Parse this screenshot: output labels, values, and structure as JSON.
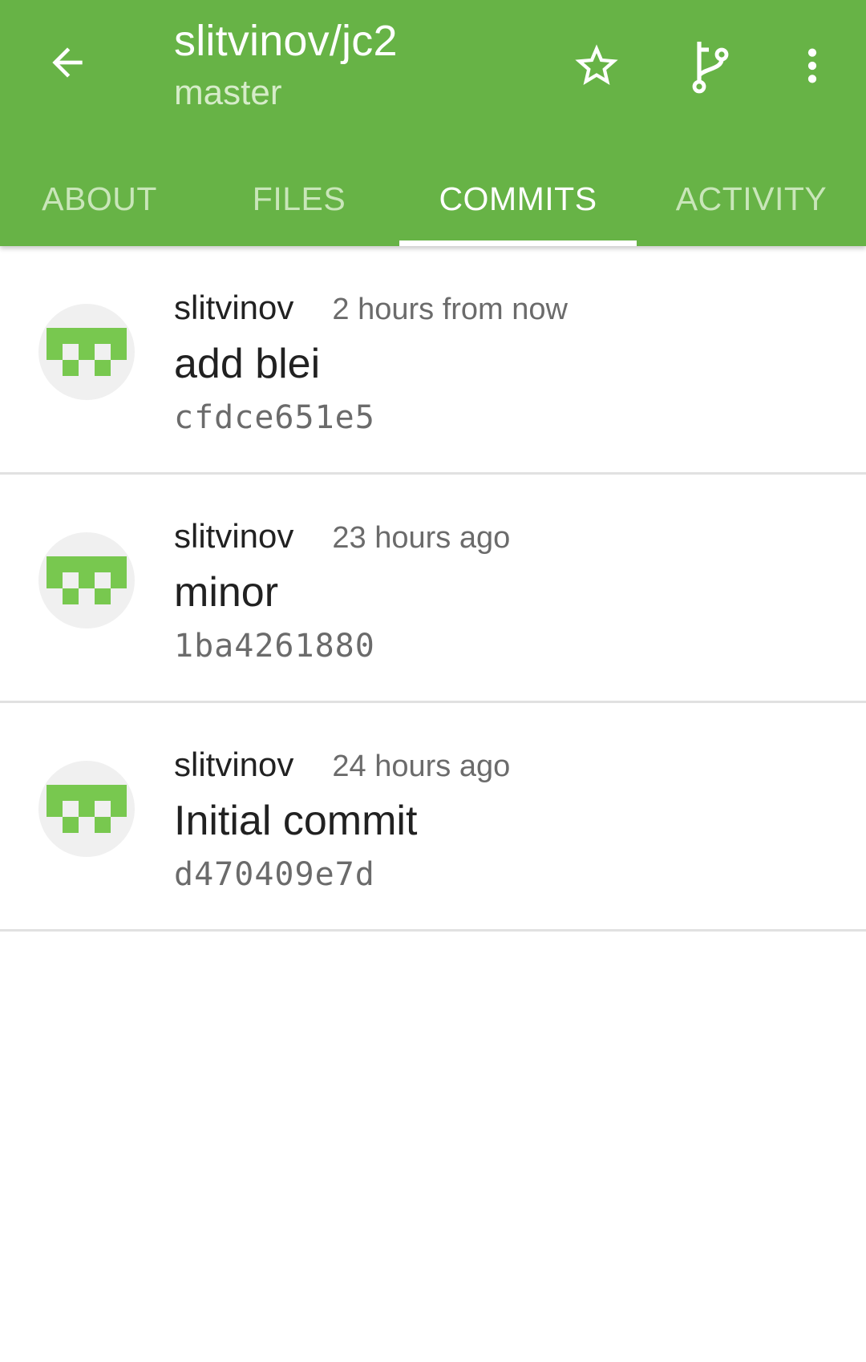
{
  "header": {
    "title": "slitvinov/jc2",
    "branch": "master",
    "back_icon": "arrow-back-icon",
    "actions": [
      "star-icon",
      "branch-icon",
      "more-vert-icon"
    ],
    "background_color": "#67b346"
  },
  "tabs": [
    {
      "label": "ABOUT",
      "active": false
    },
    {
      "label": "FILES",
      "active": false
    },
    {
      "label": "COMMITS",
      "active": true
    },
    {
      "label": "ACTIVITY",
      "active": false
    }
  ],
  "commits": [
    {
      "author": "slitvinov",
      "time": "2 hours from now",
      "message": "add blei",
      "sha": "cfdce651e5"
    },
    {
      "author": "slitvinov",
      "time": "23 hours ago",
      "message": "minor",
      "sha": "1ba4261880"
    },
    {
      "author": "slitvinov",
      "time": "24 hours ago",
      "message": "Initial commit",
      "sha": "d470409e7d"
    }
  ],
  "colors": {
    "accent": "#67b346",
    "avatar_pattern": "#78c84f"
  }
}
